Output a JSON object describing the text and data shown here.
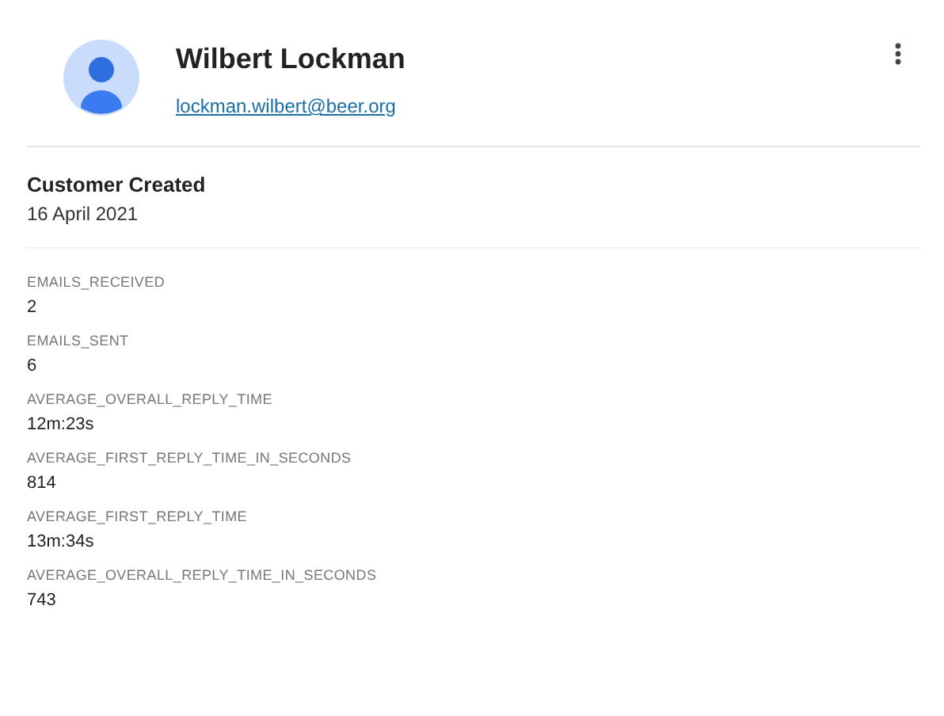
{
  "profile": {
    "name": "Wilbert Lockman",
    "email": "lockman.wilbert@beer.org"
  },
  "created": {
    "label": "Customer Created",
    "value": "16 April 2021"
  },
  "stats": [
    {
      "label": "EMAILS_RECEIVED",
      "value": "2"
    },
    {
      "label": "EMAILS_SENT",
      "value": "6"
    },
    {
      "label": "AVERAGE_OVERALL_REPLY_TIME",
      "value": "12m:23s"
    },
    {
      "label": "AVERAGE_FIRST_REPLY_TIME_IN_SECONDS",
      "value": "814"
    },
    {
      "label": "AVERAGE_FIRST_REPLY_TIME",
      "value": "13m:34s"
    },
    {
      "label": "AVERAGE_OVERALL_REPLY_TIME_IN_SECONDS",
      "value": "743"
    }
  ]
}
